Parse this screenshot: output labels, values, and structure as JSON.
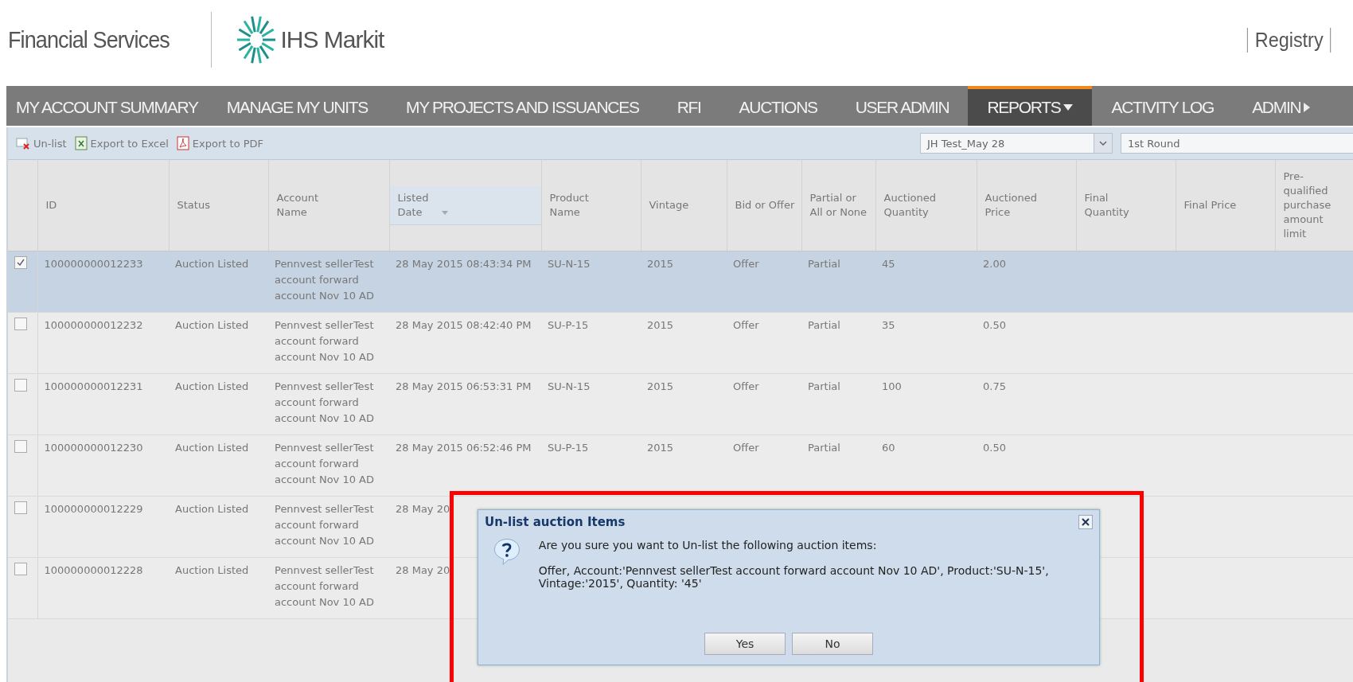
{
  "header": {
    "brand": "Financial Services",
    "logo_text": "IHS Markit",
    "links": [
      "Registry"
    ]
  },
  "nav": [
    {
      "label": "MY ACCOUNT SUMMARY",
      "selected": false,
      "kind": "plain"
    },
    {
      "label": "MANAGE MY UNITS",
      "selected": false,
      "kind": "plain"
    },
    {
      "label": "MY PROJECTS AND ISSUANCES",
      "selected": false,
      "kind": "plain"
    },
    {
      "label": "RFI",
      "selected": false,
      "kind": "plain"
    },
    {
      "label": "AUCTIONS",
      "selected": false,
      "kind": "plain"
    },
    {
      "label": "USER ADMIN",
      "selected": false,
      "kind": "plain"
    },
    {
      "label": "REPORTS",
      "selected": true,
      "kind": "dropdown"
    },
    {
      "label": "ACTIVITY LOG",
      "selected": false,
      "kind": "plain"
    },
    {
      "label": "ADMIN",
      "selected": false,
      "kind": "submenu"
    }
  ],
  "toolbar": {
    "actions": [
      {
        "label": "Un-list",
        "kind": "unlist"
      },
      {
        "label": "Export to Excel",
        "kind": "excel"
      },
      {
        "label": "Export to PDF",
        "kind": "pdf"
      }
    ],
    "auction_select": "JH Test_May 28",
    "round_select": "1st Round"
  },
  "table": {
    "columns": [
      {
        "label": "ID",
        "sorted": false
      },
      {
        "label": "Status",
        "sorted": false
      },
      {
        "label": "Account Name",
        "sorted": false
      },
      {
        "label": "Listed Date",
        "sorted": true
      },
      {
        "label": "Product Name",
        "sorted": false
      },
      {
        "label": "Vintage",
        "sorted": false
      },
      {
        "label": "Bid or Offer",
        "sorted": false
      },
      {
        "label": "Partial or All or None",
        "sorted": false
      },
      {
        "label": "Auctioned Quantity",
        "sorted": false
      },
      {
        "label": "Auctioned Price",
        "sorted": false
      },
      {
        "label": "Final Quantity",
        "sorted": false
      },
      {
        "label": "Final Price",
        "sorted": false
      },
      {
        "label": "Pre-qualified purchase amount limit",
        "sorted": false
      }
    ],
    "rows": [
      {
        "checked": true,
        "selected": true,
        "cells": [
          "100000000012233",
          "Auction Listed",
          "Pennvest sellerTest account forward account Nov 10 AD",
          "28 May 2015 08:43:34 PM",
          "SU-N-15",
          "2015",
          "Offer",
          "Partial",
          "45",
          "2.00"
        ]
      },
      {
        "checked": false,
        "selected": false,
        "cells": [
          "100000000012232",
          "Auction Listed",
          "Pennvest sellerTest account forward account Nov 10 AD",
          "28 May 2015 08:42:40 PM",
          "SU-P-15",
          "2015",
          "Offer",
          "Partial",
          "35",
          "0.50"
        ]
      },
      {
        "checked": false,
        "selected": false,
        "cells": [
          "100000000012231",
          "Auction Listed",
          "Pennvest sellerTest account forward account Nov 10 AD",
          "28 May 2015 06:53:31 PM",
          "SU-N-15",
          "2015",
          "Offer",
          "Partial",
          "100",
          "0.75"
        ]
      },
      {
        "checked": false,
        "selected": false,
        "cells": [
          "100000000012230",
          "Auction Listed",
          "Pennvest sellerTest account forward account Nov 10 AD",
          "28 May 2015 06:52:46 PM",
          "SU-P-15",
          "2015",
          "Offer",
          "Partial",
          "60",
          "0.50"
        ]
      },
      {
        "checked": false,
        "selected": false,
        "cells": [
          "100000000012229",
          "Auction Listed",
          "Pennvest sellerTest account forward account Nov 10 AD",
          "28 May 20"
        ]
      },
      {
        "checked": false,
        "selected": false,
        "cells": [
          "100000000012228",
          "Auction Listed",
          "Pennvest sellerTest account forward account Nov 10 AD",
          "28 May 20"
        ]
      }
    ]
  },
  "dialog": {
    "title": "Un-list auction Items",
    "message": "Are you sure you want to Un-list the following auction items:",
    "details": "Offer, Account:'Pennvest sellerTest account forward account Nov 10 AD', Product:'SU-N-15', Vintage:'2015', Quantity: '45'",
    "buttons": [
      "Yes",
      "No"
    ]
  }
}
